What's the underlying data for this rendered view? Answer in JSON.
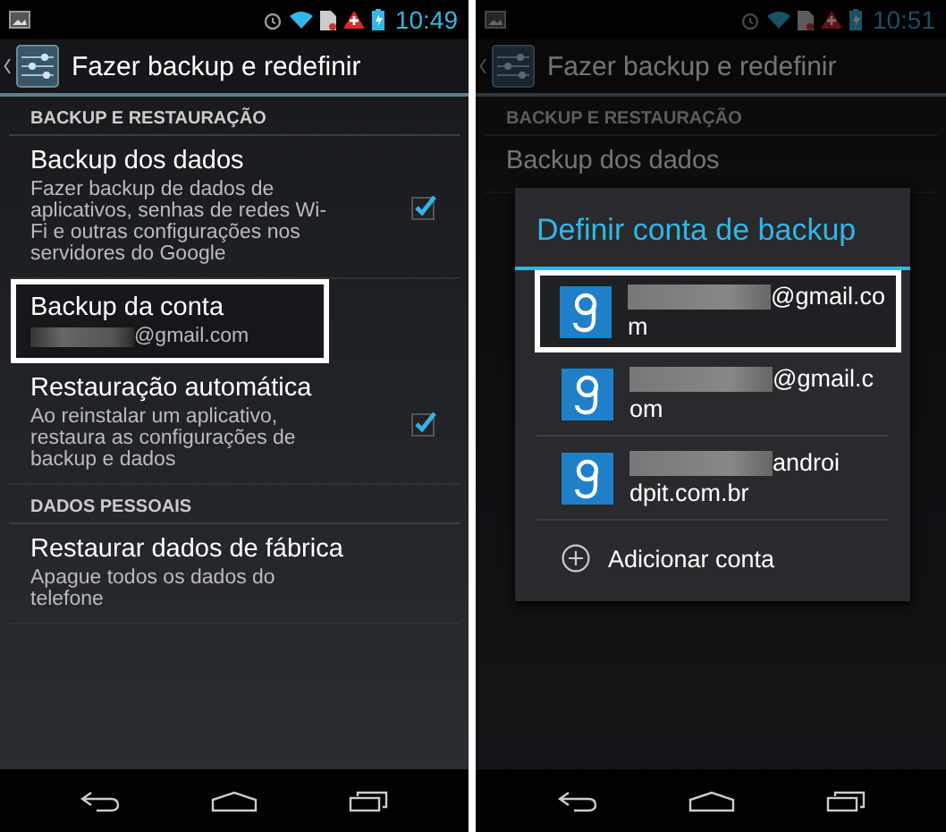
{
  "screens": [
    {
      "status_bar": {
        "time": "10:49"
      },
      "action_bar": {
        "title": "Fazer backup e redefinir"
      },
      "dimmed": false,
      "sections": [
        {
          "header": "BACKUP E RESTAURAÇÃO",
          "items": [
            {
              "kind": "checkbox",
              "title": "Backup dos dados",
              "summary": "Fazer backup de dados de aplicativos, senhas de redes Wi-Fi e outras configurações nos servidores do Google",
              "checked": true,
              "highlighted": false
            },
            {
              "kind": "account",
              "title": "Backup da conta",
              "summary": "@gmail.com",
              "highlighted": true
            },
            {
              "kind": "checkbox",
              "title": "Restauração automática",
              "summary": "Ao reinstalar um aplicativo, restaura as configurações de backup e dados",
              "checked": true,
              "highlighted": false
            }
          ]
        },
        {
          "header": "DADOS PESSOAIS",
          "items": [
            {
              "kind": "plain",
              "title": "Restaurar dados de fábrica",
              "summary": "Apague todos os dados do telefone",
              "highlighted": false
            }
          ]
        }
      ]
    },
    {
      "status_bar": {
        "time": "10:51"
      },
      "action_bar": {
        "title": "Fazer backup e redefinir"
      },
      "dimmed": true,
      "sections": [
        {
          "header": "BACKUP E RESTAURAÇÃO",
          "items": [
            {
              "kind": "plain",
              "title": "Backup dos dados",
              "highlighted": false
            }
          ]
        }
      ],
      "dialog": {
        "title": "Definir conta de backup",
        "accounts": [
          {
            "line1": "@gmail.co",
            "line2": "m",
            "highlighted": true
          },
          {
            "line1": "@gmail.c",
            "line2": "om",
            "highlighted": false
          },
          {
            "line1": "androi",
            "line2": "dpit.com.br",
            "highlighted": false
          }
        ],
        "add_label": "Adicionar conta"
      }
    }
  ]
}
